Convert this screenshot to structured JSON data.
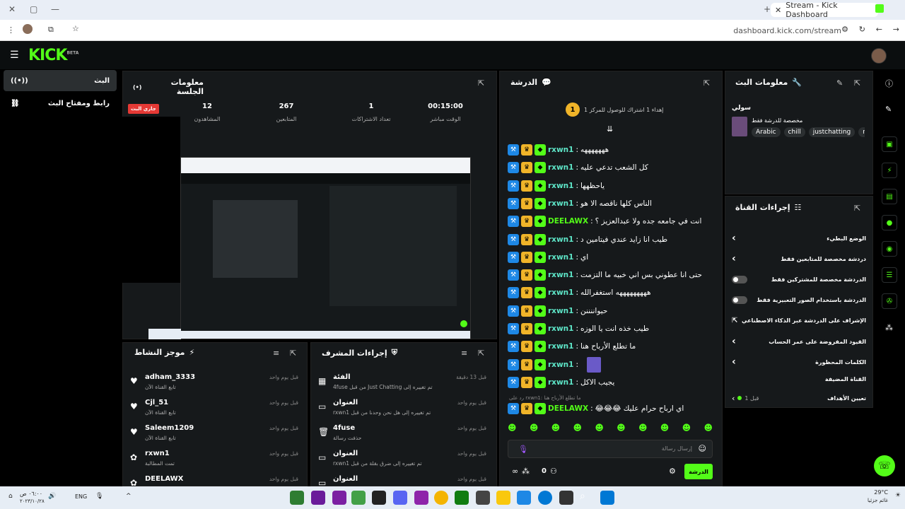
{
  "browser": {
    "tab_title": "Stream - Kick Dashboard",
    "url": "dashboard.kick.com/stream"
  },
  "brand": {
    "logo": "KICK",
    "badge": "BETA",
    "accent": "#53fc18"
  },
  "nav": [
    {
      "label": "البث",
      "icon": "broadcast-icon"
    },
    {
      "label": "رابط ومفتاح البث",
      "icon": "link-icon"
    }
  ],
  "session": {
    "title": "معلومات الجلسة",
    "live_badge": "جاري البث",
    "stats": [
      {
        "value": "00:15:00",
        "label": "الوقت مباشر"
      },
      {
        "value": "1",
        "label": "تعداد الاشتراكات"
      },
      {
        "value": "267",
        "label": "المتابعين"
      },
      {
        "value": "12",
        "label": "المشاهدون"
      }
    ]
  },
  "chat": {
    "title": "الدرشة",
    "goal_count": "1",
    "goal_text": "إهداء 1 اشتراك للوصول للمركز 1",
    "messages": [
      {
        "user": "rxwn1",
        "text": "هههههههه"
      },
      {
        "user": "rxwn1",
        "text": "كل الشعب تدعي عليه"
      },
      {
        "user": "rxwn1",
        "text": "ياحظهها"
      },
      {
        "user": "rxwn1",
        "text": "الناس كلها ناقصه الا هو"
      },
      {
        "user": "DEELAWX",
        "text": "انت في جامعه جده ولا عبدالعزيز ؟"
      },
      {
        "user": "rxwn1",
        "text": "طيب انا زايد عندي فيتامين د"
      },
      {
        "user": "rxwn1",
        "text": "اي"
      },
      {
        "user": "rxwn1",
        "text": "حتى انا عطوني بس اني خبيه ما التزمت"
      },
      {
        "user": "rxwn1",
        "text": "هههههههههه استغفرالله"
      },
      {
        "user": "rxwn1",
        "text": "حيواننننن"
      },
      {
        "user": "rxwn1",
        "text": "طيب خذه انت يا الوزه"
      },
      {
        "user": "rxwn1",
        "text": "ما تطلع الأرباح هنا"
      },
      {
        "user": "rxwn1",
        "text": ""
      },
      {
        "user": "rxwn1",
        "text": "يجيب الاكل"
      }
    ],
    "reply_hint": "رد على rxwn1: ما تطلع الأرباح هنا",
    "last": {
      "user": "DEELAWX",
      "text": "اي ارباح حرام عليك 😂😂😂"
    },
    "input_placeholder": "إرسال رسالة",
    "send_label": "الدرشة",
    "viewer_count": "0"
  },
  "stream_info": {
    "title": "معلومات البث",
    "stream_title": "سولي",
    "category": "مخصصة للدرشة فقط",
    "tags": [
      "Arabic",
      "chill",
      "justchatting",
      "re"
    ]
  },
  "channel_actions": {
    "title": "إجراءات القناة",
    "items": [
      {
        "label": "الوضع البطيء",
        "kind": "arrow"
      },
      {
        "label": "دردشة مخصصة للمتابعين فقط",
        "kind": "arrow"
      },
      {
        "label": "الدردشة مخصصة للمشتركين فقط",
        "kind": "toggle"
      },
      {
        "label": "الدردشة باستخدام الصور التعبيرية فقط",
        "kind": "toggle"
      },
      {
        "label": "الإشراف على الدردشة عبر الذكاء الاصطناعي",
        "kind": "link"
      },
      {
        "label": "القيود المفروضة على عمر الحساب",
        "kind": "arrow"
      },
      {
        "label": "الكلمات المحظورة",
        "kind": "arrow"
      }
    ],
    "section": "القناة المضيفة",
    "host_label": "تعيين الأهداف",
    "host_value": "قبل 1"
  },
  "activity": {
    "title": "موجز النشاط",
    "items": [
      {
        "user": "adham_3333",
        "desc": "تابع القناة الآن",
        "time": "قبل يوم واحد",
        "icon": "heart-icon"
      },
      {
        "user": "Cjl_51",
        "desc": "تابع القناة الآن",
        "time": "قبل يوم واحد",
        "icon": "heart-icon"
      },
      {
        "user": "Saleem1209",
        "desc": "تابع القناة الآن",
        "time": "قبل يوم واحد",
        "icon": "heart-icon"
      },
      {
        "user": "rxwn1",
        "desc": "تمت المطالبة",
        "time": "قبل يوم واحد",
        "icon": "gift-icon"
      },
      {
        "user": "DEELAWX",
        "desc": "",
        "time": "قبل يوم واحد",
        "icon": "gift-icon"
      }
    ]
  },
  "mod_actions": {
    "title": "إجراءات المشرف",
    "items": [
      {
        "user": "الفئة",
        "desc": "تم تغييره إلى Just Chatting من قبل 4fuse",
        "time": "قبل 13 دقيقة",
        "icon": "category-icon"
      },
      {
        "user": "العنوان",
        "desc": "تم تغييره إلى هل نحن وحدنا من قبل rxwn1",
        "time": "قبل يوم واحد",
        "icon": "title-icon"
      },
      {
        "user": "4fuse",
        "desc": "حذفت رسالة",
        "time": "قبل يوم واحد",
        "icon": "trash-icon"
      },
      {
        "user": "العنوان",
        "desc": "تم تغييره إلى ضرق بقلة من قبل rxwn1",
        "time": "قبل يوم واحد",
        "icon": "title-icon"
      },
      {
        "user": "العنوان",
        "desc": "",
        "time": "قبل يوم واحد",
        "icon": "title-icon"
      }
    ]
  },
  "taskbar": {
    "weather": "29°C",
    "weather_desc": "غائم جزئيا",
    "lang": "ENG",
    "time": "٠٦:٠٠ ص",
    "date": "٢٠٢٣/١٠/٢٨"
  }
}
